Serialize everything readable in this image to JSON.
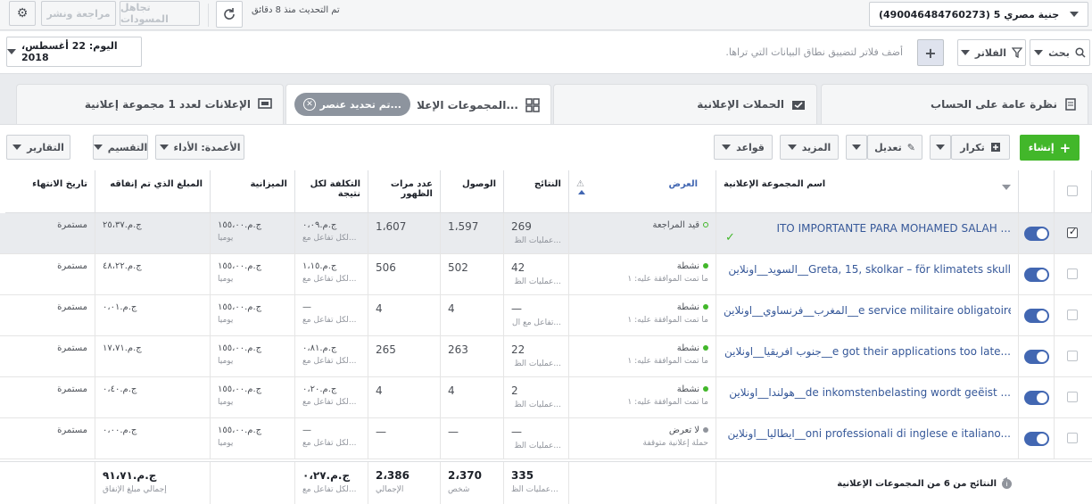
{
  "topbar": {
    "account": "جنية مصري 5 (490046484760273)",
    "updated": "تم التحديث منذ 8 دقائق",
    "ignore_drafts": "تجاهل المسودات",
    "review_publish": "مراجعة ونشر"
  },
  "filterbar": {
    "search": "بحث",
    "filters": "الفلاتر",
    "placeholder": "أضف فلاتر لتضييق نطاق البيانات التي تراها.",
    "date": "اليوم: 22 أغسطس، 2018"
  },
  "tabs": {
    "account_overview": "نظرة عامة على الحساب",
    "campaigns": "الحملات الإعلانية",
    "ad_sets": "المجموعات الإعلا...",
    "selected_chip": "تم تحديد عنصر...",
    "ads": "الإعلانات لعدد 1 مجموعة إعلانية"
  },
  "toolbar": {
    "create": "إنشاء",
    "duplicate": "تكرار",
    "edit": "تعديل",
    "more": "المزيد",
    "rules": "قواعد",
    "columns": "الأعمدة: الأداء",
    "breakdown": "التقسيم",
    "reports": "التقارير"
  },
  "headers": {
    "name": "اسم المجموعة الإعلانية",
    "delivery": "العرض",
    "results": "النتائج",
    "reach": "الوصول",
    "impressions": "عدد مرات الظهور",
    "cost": "التكلفة لكل نتيجة",
    "budget": "الميزانية",
    "spent": "المبلغ الذي تم إنفاقه",
    "end": "تاريخ الانتهاء"
  },
  "rows": [
    {
      "name": "ITO IMPORTANTE PARA MOHAMED SALAH ...",
      "status": "قيد المراجعة",
      "status_sub": "",
      "status_color": "#42b72a",
      "results": "269",
      "results_sub": "عمليات الظ...",
      "reach": "1،597",
      "impressions": "1،607",
      "cost": "ج.م.٠،٠٩",
      "cost_sub": "لكل تفاعل مع...",
      "budget": "ج.م.١٥٥،٠٠",
      "budget_sub": "يومياً",
      "spent": "ج.م.٢٥،٣٧",
      "end": "مستمرة"
    },
    {
      "name": "السويد__اونلاين__Greta, 15, skolkar – för klimatets skull",
      "status": "نشطة",
      "status_sub": "ما تمت الموافقة عليه: ١",
      "status_color": "#42b72a",
      "results": "42",
      "results_sub": "عمليات الظ...",
      "reach": "502",
      "impressions": "506",
      "cost": "ج.م.١،١٥",
      "cost_sub": "لكل تفاعل مع...",
      "budget": "ج.م.١٥٥،٠٠",
      "budget_sub": "يومياً",
      "spent": "ج.م.٤٨،٢٢",
      "end": "مستمرة"
    },
    {
      "name": "المغرب__فرنساوي__اونلاين__e service militaire obligatoire.",
      "status": "نشطة",
      "status_sub": "ما تمت الموافقة عليه: ١",
      "status_color": "#42b72a",
      "results": "—",
      "results_sub": "تفاعل مع ال...",
      "reach": "4",
      "impressions": "4",
      "cost": "—",
      "cost_sub": "لكل تفاعل مع...",
      "budget": "ج.م.١٥٥،٠٠",
      "budget_sub": "يومياً",
      "spent": "ج.م.٠،٠١",
      "end": "مستمرة"
    },
    {
      "name": "جنوب افريقيا__اونلاين__e got their applications too late...",
      "status": "نشطة",
      "status_sub": "ما تمت الموافقة عليه: ١",
      "status_color": "#42b72a",
      "results": "22",
      "results_sub": "عمليات الظ...",
      "reach": "263",
      "impressions": "265",
      "cost": "ج.م.٠،٨١",
      "cost_sub": "لكل تفاعل مع...",
      "budget": "ج.م.١٥٥،٠٠",
      "budget_sub": "يومياً",
      "spent": "ج.م.١٧،٧١",
      "end": "مستمرة"
    },
    {
      "name": "هولندا__اونلاين__de inkomstenbelasting wordt geëist ...",
      "status": "نشطة",
      "status_sub": "ما تمت الموافقة عليه: ١",
      "status_color": "#42b72a",
      "results": "2",
      "results_sub": "عمليات الظ...",
      "reach": "4",
      "impressions": "4",
      "cost": "ج.م.٠،٢٠",
      "cost_sub": "لكل تفاعل مع...",
      "budget": "ج.م.١٥٥،٠٠",
      "budget_sub": "يومياً",
      "spent": "ج.م.٠،٤٠",
      "end": "مستمرة"
    },
    {
      "name": "ايطاليا__اونلاين__oni professionali di inglese e italiano...",
      "status": "لا تعرض",
      "status_sub": "حملة إعلانية متوقفة",
      "status_color": "#90949c",
      "results": "—",
      "results_sub": "عمليات الظ...",
      "reach": "—",
      "impressions": "—",
      "cost": "—",
      "cost_sub": "لكل تفاعل مع...",
      "budget": "ج.م.١٥٥،٠٠",
      "budget_sub": "يومياً",
      "spent": "ج.م.٠،٠٠",
      "end": "مستمرة"
    }
  ],
  "summary": {
    "label": "النتائج من 6 من المجموعات الإعلانية",
    "results": "335",
    "results_sub": "عمليات الظ...",
    "reach": "2،370",
    "reach_sub": "شخص",
    "impressions": "2،386",
    "impressions_sub": "الإجمالي",
    "cost": "ج.م.٠،٢٧",
    "cost_sub": "لكل تفاعل مع...",
    "spent": "ج.م.٩١،٧١",
    "spent_sub": "إجمالي مبلغ الإنفاق"
  },
  "colors": {
    "accent": "#4267b2",
    "create": "#42b72a",
    "link": "#365899"
  }
}
